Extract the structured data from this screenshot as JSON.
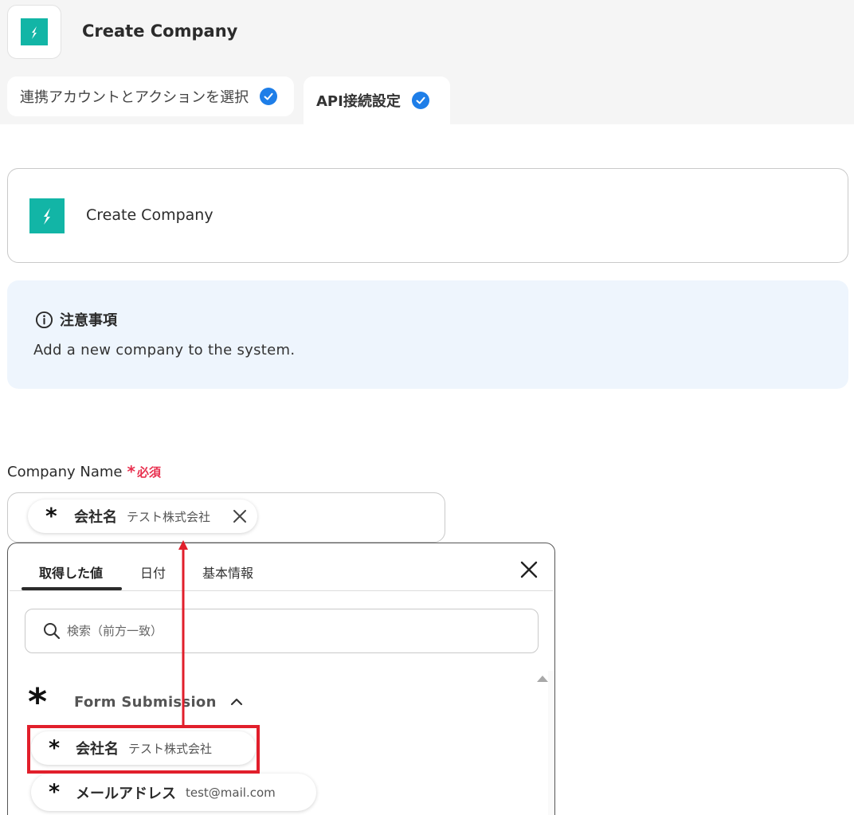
{
  "header": {
    "title": "Create Company"
  },
  "tabs": [
    {
      "label": "連携アカウントとアクションを選択"
    },
    {
      "label": "API接続設定"
    }
  ],
  "action": {
    "title": "Create Company"
  },
  "notice": {
    "heading": "注意事項",
    "body": "Add a new company to the system."
  },
  "field": {
    "label": "Company Name",
    "required_mark": "*",
    "required_text": "必須",
    "chip": {
      "label": "会社名",
      "value": "テスト株式会社"
    }
  },
  "popup": {
    "tabs": [
      "取得した値",
      "日付",
      "基本情報"
    ],
    "search": {
      "placeholder": "検索（前方一致）"
    },
    "group": {
      "label": "Form Submission"
    },
    "items": [
      {
        "label": "会社名",
        "value": "テスト株式会社"
      },
      {
        "label": "メールアドレス",
        "value": "test@mail.com"
      }
    ]
  },
  "colors": {
    "brand": "#12b5a6",
    "accent": "#1e7ee8",
    "required": "#e8304f",
    "highlight": "#e11f2b"
  },
  "icons": [
    "yoom-logo-icon",
    "check-circle-icon",
    "info-icon",
    "close-icon",
    "search-icon",
    "chevron-up-icon",
    "asterisk-icon"
  ]
}
